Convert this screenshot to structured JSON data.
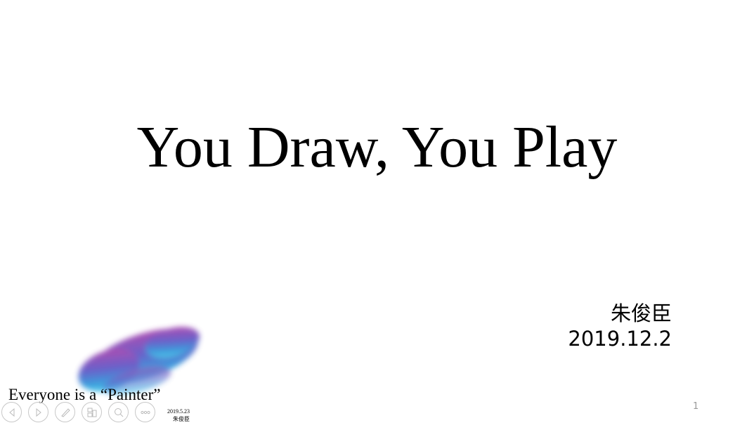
{
  "slide": {
    "title": "You Draw, You Play",
    "author": "朱俊臣",
    "date": "2019.12.2",
    "tagline": "Everyone is a “Painter”",
    "footer_date": "2019.5.23",
    "footer_author": "朱俊臣",
    "page_number": "1"
  },
  "nav": {
    "buttons": [
      "previous",
      "next",
      "pen",
      "slides",
      "zoom",
      "more"
    ]
  },
  "colors": {
    "paint_top": "#a040a8",
    "paint_mid": "#5050c0",
    "paint_bottom": "#20b8e0"
  }
}
